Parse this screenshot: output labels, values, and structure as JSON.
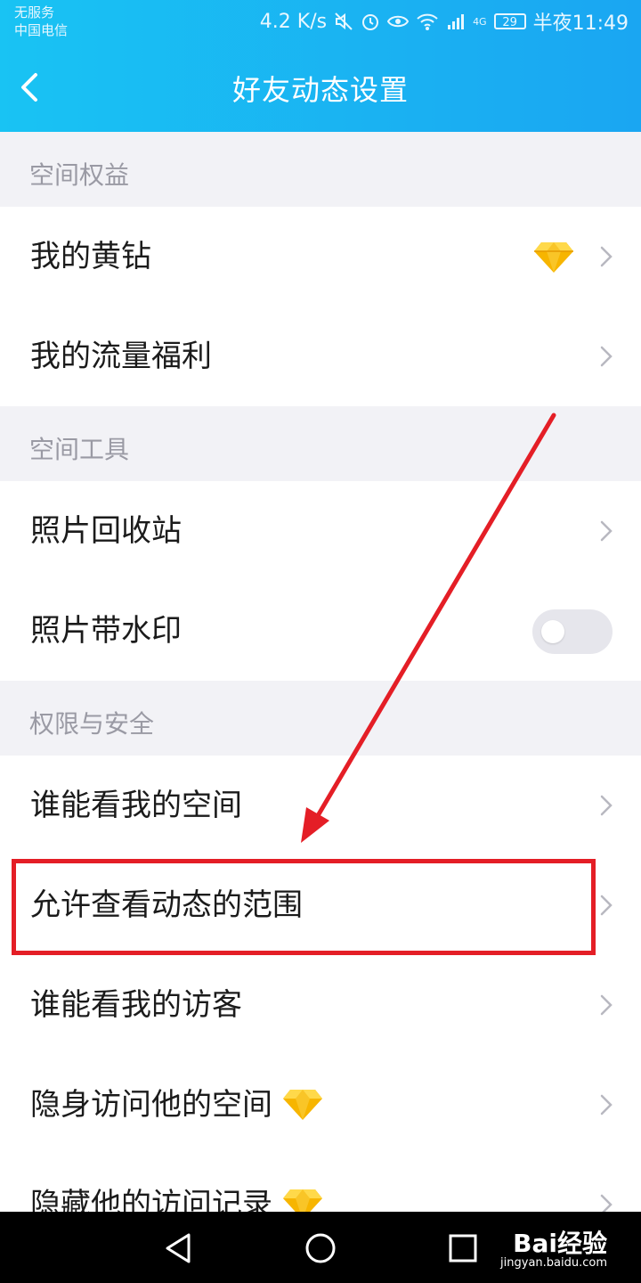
{
  "status_bar": {
    "carrier_line1": "无服务",
    "carrier_line2": "中国电信",
    "speed": "4.2 K/s",
    "network": "4G",
    "battery": "29",
    "time": "半夜11:49"
  },
  "header": {
    "title": "好友动态设置",
    "background": "#1ab2f3"
  },
  "sections": [
    {
      "title": "空间权益",
      "items": [
        "我的黄钻",
        "我的流量福利"
      ]
    },
    {
      "title": "空间工具",
      "items": [
        "照片回收站",
        "照片带水印"
      ]
    },
    {
      "title": "权限与安全",
      "items": [
        "谁能看我的空间",
        "允许查看动态的范围",
        "谁能看我的访客",
        "隐身访问他的空间",
        "隐藏他的访问记录"
      ]
    }
  ],
  "toggles": {
    "watermark_enabled": false
  },
  "annotation": {
    "highlight_color": "#e41e26",
    "highlighted_item": "允许查看动态的范围"
  },
  "nav": {
    "back_icon": "triangle-back-icon",
    "home_icon": "circle-home-icon",
    "recent_icon": "square-recent-icon"
  },
  "watermark": {
    "logo": "Bai经验",
    "url": "jingyan.baidu.com"
  }
}
